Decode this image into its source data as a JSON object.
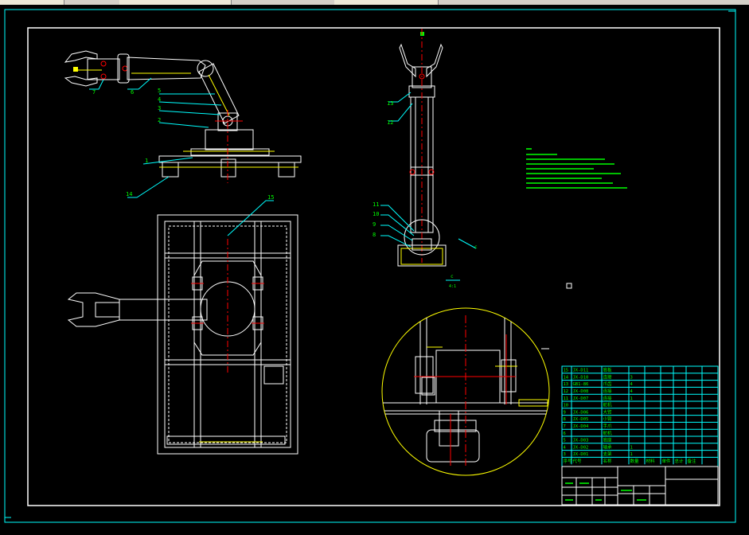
{
  "colors": {
    "background": "#000000",
    "frame": "#00ffff",
    "geometry": "#ffffff",
    "centerline": "#ff0000",
    "leader": "#00ffff",
    "note_text": "#00ff00",
    "detail_circle": "#ffff00"
  },
  "top_view_labels": [
    "7",
    "6",
    "5",
    "4",
    "3",
    "2",
    "1",
    "14"
  ],
  "plan_view_labels": [
    "15"
  ],
  "side_view_labels": [
    "13",
    "12",
    "11",
    "10",
    "9",
    "8"
  ],
  "section_marks": {
    "section_letter": "c",
    "scale_top": "c",
    "scale_bottom": "4:1"
  },
  "parts_table": {
    "rows": [
      [
        "15",
        "JX-D11",
        "底板",
        "",
        ""
      ],
      [
        "14",
        "JX-D10",
        "连接",
        "3",
        ""
      ],
      [
        "13",
        "GB1-86",
        "爪齿",
        "4",
        ""
      ],
      [
        "12",
        "JX-D08",
        "连接",
        "4",
        ""
      ],
      [
        "11",
        "JX-D07",
        "连接",
        "1",
        ""
      ],
      [
        "10",
        "",
        "舵机",
        "",
        ""
      ],
      [
        "9",
        "JX-D06",
        "大臂",
        "",
        ""
      ],
      [
        "8",
        "JX-D05",
        "小臂",
        "",
        ""
      ],
      [
        "7",
        "JX-D04",
        "手爪",
        "",
        ""
      ],
      [
        "6",
        "",
        "舵机",
        "",
        ""
      ],
      [
        "5",
        "JX-D03",
        "底座",
        "",
        ""
      ],
      [
        "4",
        "JX-D02",
        "轴承",
        "1",
        ""
      ],
      [
        "3",
        "JX-D01",
        "支架",
        "1",
        ""
      ]
    ],
    "header": [
      "序号",
      "代号",
      "名称",
      "数量",
      "材料",
      "单件",
      "总计",
      "备注"
    ]
  }
}
